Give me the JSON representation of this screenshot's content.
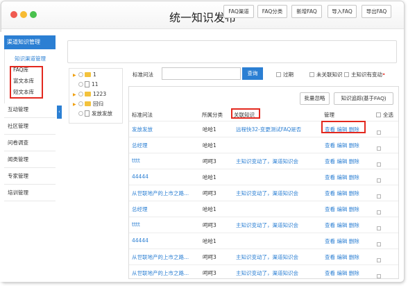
{
  "window": {
    "title": "统一知识发布"
  },
  "sidebar": {
    "header": "渠道知识管理",
    "sub_title": "知识渠道管理",
    "sub_items": [
      "FAQ库",
      "富文本库",
      "短文本库"
    ],
    "menu": [
      "互动管理",
      "社区管理",
      "问卷调查",
      "闻类管理",
      "专家管理",
      "培训管理"
    ],
    "collapse_icon": "‹"
  },
  "toolbar": {
    "buttons": [
      "FAQ渠道",
      "FAQ分类",
      "新增FAQ",
      "导入FAQ",
      "导出FAQ"
    ]
  },
  "tree": {
    "nodes": [
      {
        "label": "1",
        "type": "folder",
        "expand": true
      },
      {
        "label": "11",
        "type": "file",
        "expand": false
      },
      {
        "label": "1223",
        "type": "folder",
        "expand": true
      },
      {
        "label": "回归",
        "type": "folder",
        "expand": true
      },
      {
        "label": "发放发放",
        "type": "file",
        "expand": false
      }
    ]
  },
  "search": {
    "label": "标准问法",
    "value": "",
    "button": "查询",
    "filters": [
      "过期",
      "未关联知识",
      "主知识有变动"
    ]
  },
  "panel": {
    "buttons": [
      "批量忽略",
      "知识追踪(基于FAQ)"
    ],
    "headers": [
      "标准问法",
      "所属分类",
      "关联知识",
      "管理",
      "全选"
    ],
    "rows": [
      {
        "q": "发放发放",
        "cat": "哈哈1",
        "rel": "远程快32-变更测试FAQ是否",
        "actions": [
          "查看",
          "编辑",
          "删除"
        ]
      },
      {
        "q": "总经理",
        "cat": "哈哈1",
        "rel": "",
        "actions": [
          "查看",
          "编辑",
          "删除"
        ]
      },
      {
        "q": "tttt",
        "cat": "呵呵3",
        "rel": "主知识变动了，渠道知识会",
        "actions": [
          "查看",
          "编辑",
          "删除"
        ]
      },
      {
        "q": "44444",
        "cat": "哈哈1",
        "rel": "",
        "actions": [
          "查看",
          "编辑",
          "删除"
        ]
      },
      {
        "q": "从世联地产的上市之路...",
        "cat": "呵呵3",
        "rel": "主知识变动了，渠道知识会",
        "actions": [
          "查看",
          "编辑",
          "删除"
        ]
      },
      {
        "q": "总经理",
        "cat": "哈哈1",
        "rel": "",
        "actions": [
          "查看",
          "编辑",
          "删除"
        ]
      },
      {
        "q": "tttt",
        "cat": "呵呵3",
        "rel": "主知识变动了，渠道知识会",
        "actions": [
          "查看",
          "编辑",
          "删除"
        ]
      },
      {
        "q": "44444",
        "cat": "哈哈1",
        "rel": "",
        "actions": [
          "查看",
          "编辑",
          "删除"
        ]
      },
      {
        "q": "从世联地产的上市之路...",
        "cat": "呵呵3",
        "rel": "主知识变动了，渠道知识会",
        "actions": [
          "查看",
          "编辑",
          "删除"
        ]
      },
      {
        "q": "从世联地产的上市之路...",
        "cat": "呵呵3",
        "rel": "主知识变动了，渠道知识会",
        "actions": [
          "查看",
          "编辑",
          "删除"
        ]
      }
    ]
  },
  "colors": {
    "accent": "#2b7fd3",
    "highlight_box": "#e3281e"
  }
}
